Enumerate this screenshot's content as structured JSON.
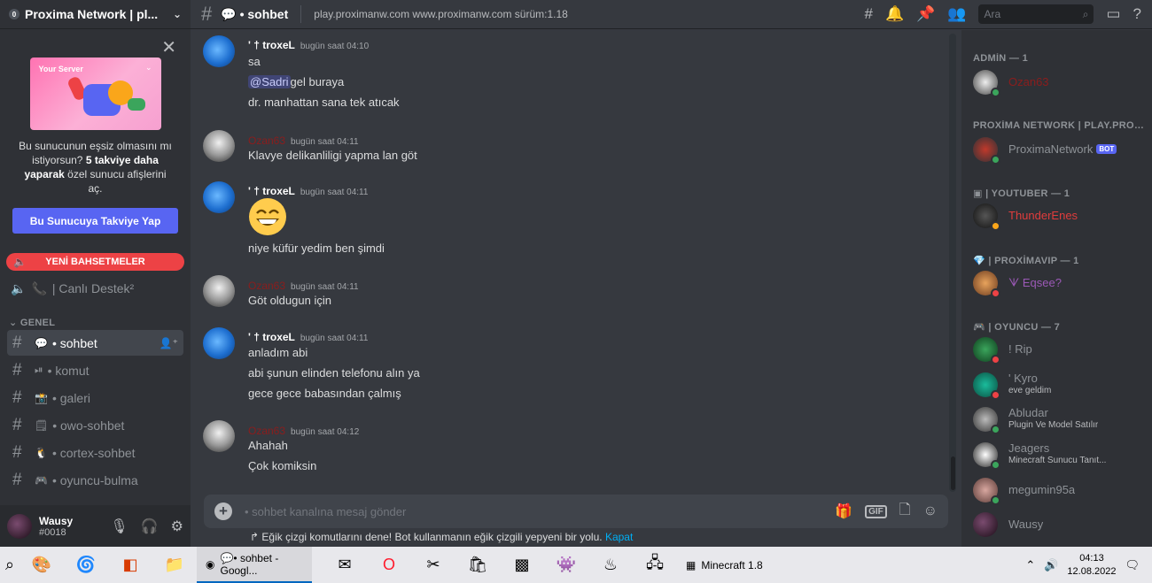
{
  "server": {
    "name": "Proxima Network | pl...",
    "badge": "0"
  },
  "boost": {
    "art_title": "Your Server",
    "text_1": "Bu sunucunun eşsiz olmasını mı istiyorsun?",
    "text_bold": "5 takviye daha yaparak",
    "text_2": "özel sunucu afişlerini aç.",
    "button": "Bu Sunucuya Takviye Yap"
  },
  "mentions_pill": "YENİ BAHSETMELER",
  "voice_channel": "| Canlı Destek²",
  "category": "GENEL",
  "channels": [
    {
      "emoji": "💬",
      "name": "• sohbet"
    },
    {
      "emoji": "⏯",
      "name": "• komut"
    },
    {
      "emoji": "📸",
      "name": "• galeri"
    },
    {
      "emoji": "🗒",
      "name": "• owo-sohbet"
    },
    {
      "emoji": "🐧",
      "name": "• cortex-sohbet"
    },
    {
      "emoji": "🎮",
      "name": "• oyuncu-bulma"
    }
  ],
  "user": {
    "name": "Wausy",
    "tag": "#0018"
  },
  "topbar": {
    "channel_emoji": "💬",
    "channel": "• sohbet",
    "topic": "play.proximanw.com www.proximanw.com sürüm:1.18",
    "search_placeholder": "Ara"
  },
  "messages": [
    {
      "author": "' † troxeL",
      "time": "bugün saat 04:10",
      "lines": [
        "sa",
        "gel buraya",
        "dr. manhattan sana tek atıcak"
      ],
      "mention": "@Sadri"
    },
    {
      "author": "Ozan63",
      "time": "bugün saat 04:11",
      "lines": [
        "Klavye delikanliligi yapma lan göt"
      ]
    },
    {
      "author": "' † troxeL",
      "time": "bugün saat 04:11",
      "emoji": "😄",
      "lines": [
        "niye küfür yedim ben şimdi"
      ]
    },
    {
      "author": "Ozan63",
      "time": "bugün saat 04:11",
      "lines": [
        "Göt oldugun için"
      ]
    },
    {
      "author": "' † troxeL",
      "time": "bugün saat 04:11",
      "lines": [
        "anladım abi",
        "abi şunun elinden telefonu alın ya",
        "gece gece babasından çalmış"
      ]
    },
    {
      "author": "Ozan63",
      "time": "bugün saat 04:12",
      "lines": [
        "Ahahah",
        "Çok komiksin"
      ]
    }
  ],
  "composer": {
    "placeholder": "• sohbet kanalına mesaj gönder",
    "gif": "GIF"
  },
  "hint": {
    "text": "Eğik çizgi komutlarını dene! Bot kullanmanın eğik çizgili yepyeni bir yolu.",
    "link": "Kapat"
  },
  "member_groups": [
    {
      "title": "ADMİN — 1"
    },
    {
      "title": "PROXİMA NETWORK | PLAY.PROX..."
    },
    {
      "title": "| YOUTUBER — 1"
    },
    {
      "title": "| PROXİMAVIP — 1"
    },
    {
      "title": "| OYUNCU — 7"
    }
  ],
  "members": [
    {
      "name": "Ozan63",
      "sub": "",
      "status": "online"
    },
    {
      "name": "ProximaNetwork",
      "sub": "",
      "badge": "BOT",
      "status": "online"
    },
    {
      "name": "ThunderEnes",
      "sub": "",
      "status": "idle"
    },
    {
      "name": "ᗐ Eqsee?",
      "sub": "",
      "status": "dnd"
    },
    {
      "name": "! Rip",
      "sub": "",
      "status": "dnd"
    },
    {
      "name": "' Kyro",
      "sub": "eve geldim",
      "status": "dnd"
    },
    {
      "name": "Abludar",
      "sub": "Plugin Ve Model Satılır",
      "status": "online"
    },
    {
      "name": "Jeagers",
      "sub": "Minecraft Sunucu Tanıt...",
      "status": "online"
    },
    {
      "name": "megumin95a",
      "sub": "",
      "status": "online"
    },
    {
      "name": "Wausy",
      "sub": "",
      "status": ""
    }
  ],
  "taskbar": {
    "chrome_label": "💬• sohbet - Googl...",
    "minecraft_label": "Minecraft 1.8",
    "time": "04:13",
    "date": "12.08.2022"
  },
  "colors": {
    "accent": "#5865f2",
    "danger": "#ed4245",
    "online": "#3ba55c",
    "link": "#00aff4"
  }
}
